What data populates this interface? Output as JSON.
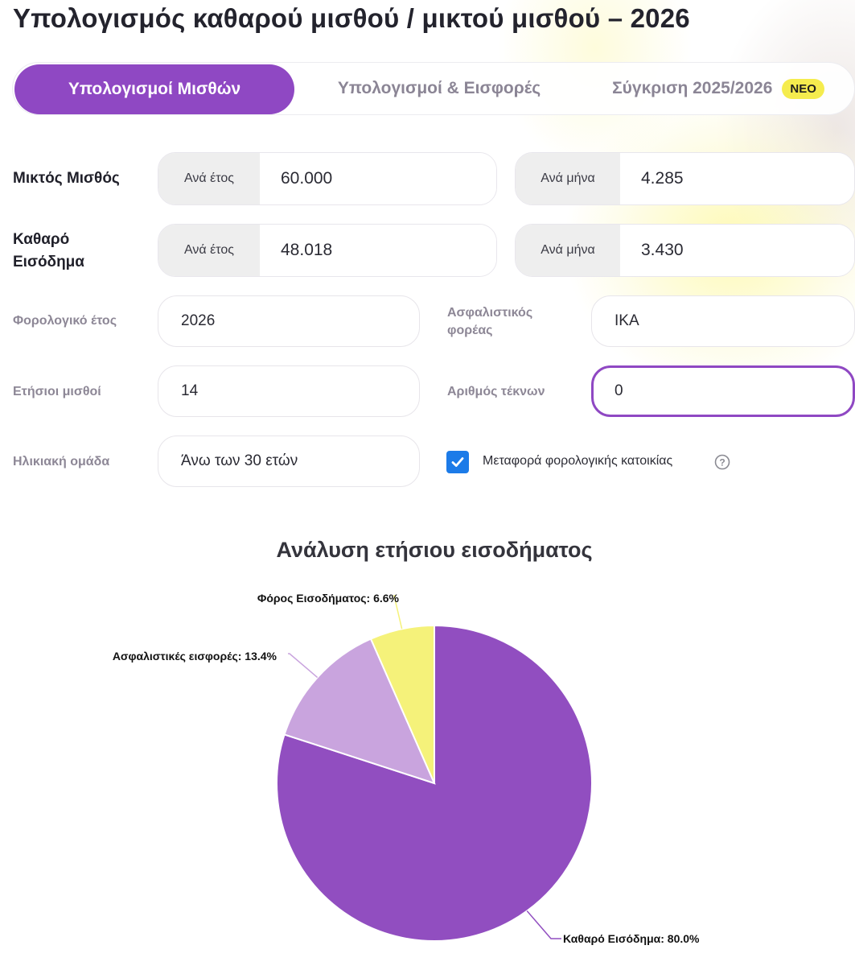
{
  "page": {
    "title": "Υπολογισμός καθαρού μισθού / μικτού μισθού – 2026"
  },
  "tabs": [
    {
      "label": "Υπολογισμοί Μισθών",
      "active": true
    },
    {
      "label": "Υπολογισμοί & Εισφορές",
      "active": false
    },
    {
      "label": "Σύγκριση 2025/2026",
      "active": false,
      "badge": "ΝΕΟ"
    }
  ],
  "gross": {
    "label": "Μικτός Μισθός",
    "yearly_prefix": "Ανά έτος",
    "yearly_value": "60.000",
    "monthly_prefix": "Ανά μήνα",
    "monthly_value": "4.285"
  },
  "net": {
    "label_line1": "Καθαρό",
    "label_line2": "Εισόδημα",
    "yearly_prefix": "Ανά έτος",
    "yearly_value": "48.018",
    "monthly_prefix": "Ανά μήνα",
    "monthly_value": "3.430"
  },
  "form": {
    "tax_year_label": "Φορολογικό έτος",
    "tax_year_value": "2026",
    "insurer_label_line1": "Ασφαλιστικός",
    "insurer_label_line2": "φορέας",
    "insurer_value": "ΙΚΑ",
    "salaries_label": "Ετήσιοι μισθοί",
    "salaries_value": "14",
    "children_label": "Αριθμός τέκνων",
    "children_value": "0",
    "age_label": "Ηλικιακή ομάδα",
    "age_value": "Άνω των 30 ετών",
    "residence_label": "Μεταφορά φορολογικής κατοικίας",
    "residence_checked": true
  },
  "icons": {
    "check": "checkmark-icon",
    "help": "question-circle-icon"
  },
  "colors": {
    "accent": "#8f48c3",
    "badge": "#f5ec4e",
    "checkbox": "#1c7be8"
  },
  "chart_data": {
    "type": "pie",
    "title": "Ανάλυση ετήσιου εισοδήματος",
    "slices": [
      {
        "name": "Καθαρό Εισόδημα",
        "value": 80.0,
        "color": "#914ec0",
        "label": "Καθαρό Εισόδημα: 80.0%"
      },
      {
        "name": "Ασφαλιστικές εισφορές",
        "value": 13.4,
        "color": "#c9a4de",
        "label": "Ασφαλιστικές εισφορές: 13.4%"
      },
      {
        "name": "Φόρος Εισοδήματος",
        "value": 6.6,
        "color": "#f5f27a",
        "label": "Φόρος Εισοδήματος: 6.6%"
      }
    ]
  }
}
